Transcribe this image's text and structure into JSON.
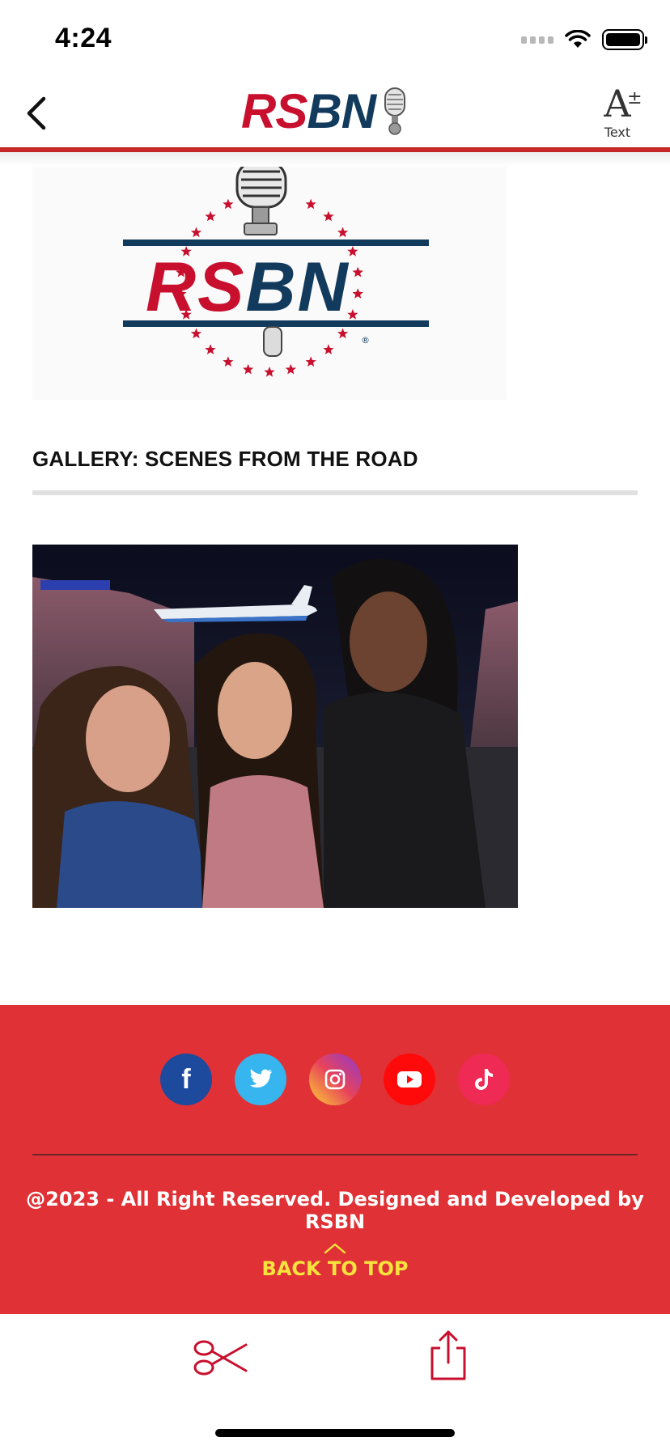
{
  "status_bar": {
    "time": "4:24"
  },
  "header": {
    "logo_part1": "RS",
    "logo_part2": "BN",
    "text_button_label": "Text"
  },
  "article": {
    "logo_part1": "RSBN",
    "title": "GALLERY: SCENES FROM THE ROAD"
  },
  "footer": {
    "social": [
      {
        "name": "facebook",
        "icon": "facebook-icon",
        "color": "#1d4a9c"
      },
      {
        "name": "twitter",
        "icon": "twitter-icon",
        "color": "#37b5ef"
      },
      {
        "name": "instagram",
        "icon": "instagram-icon",
        "color": "#e8435a"
      },
      {
        "name": "youtube",
        "icon": "youtube-icon",
        "color": "#ff0a0a"
      },
      {
        "name": "tiktok",
        "icon": "tiktok-icon",
        "color": "#ef2a55"
      }
    ],
    "copyright": "@2023 - All Right Reserved. Designed and Developed by RSBN",
    "back_to_top": "BACK TO TOP"
  },
  "colors": {
    "brand_red": "#c8102e",
    "brand_navy": "#123a5c",
    "footer_bg": "#e03236",
    "back_to_top": "#f6e43c"
  },
  "toolbar": {
    "scissors_icon": "scissors-icon",
    "share_icon": "share-icon"
  }
}
